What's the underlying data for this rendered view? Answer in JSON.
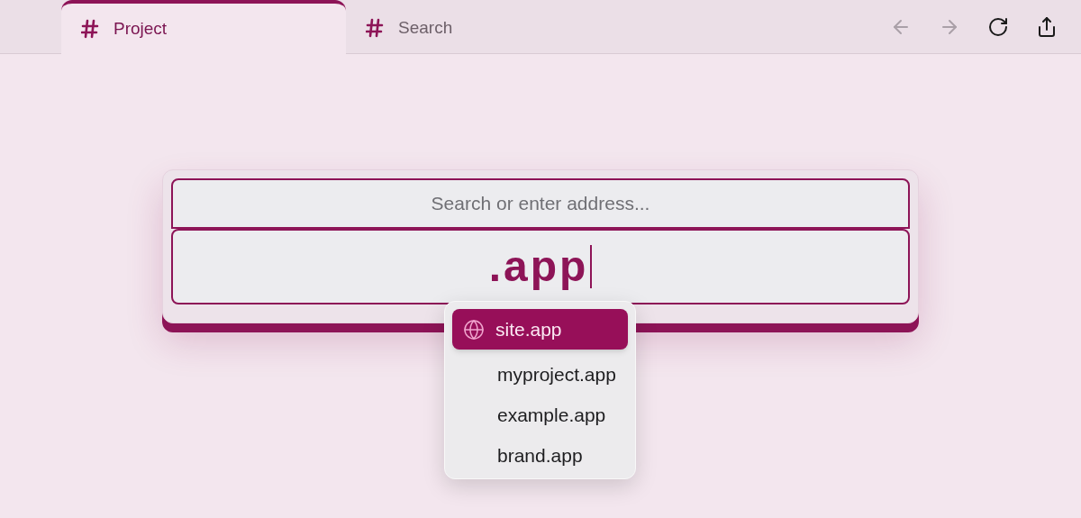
{
  "tabs": [
    {
      "label": "Project",
      "selected": true
    },
    {
      "label": "Search",
      "selected": false
    }
  ],
  "toolbar": [
    {
      "kind": "back",
      "disabled": true
    },
    {
      "kind": "forward",
      "disabled": true
    },
    {
      "kind": "reload",
      "disabled": false
    },
    {
      "kind": "share",
      "disabled": false
    }
  ],
  "search": {
    "placeholder": "Search or enter address..."
  },
  "address": {
    "value": ".app"
  },
  "suggestions": [
    {
      "label": "site.app",
      "selected": true
    },
    {
      "label": "myproject.app",
      "selected": false
    },
    {
      "label": "example.app",
      "selected": false
    },
    {
      "label": "brand.app",
      "selected": false
    }
  ]
}
